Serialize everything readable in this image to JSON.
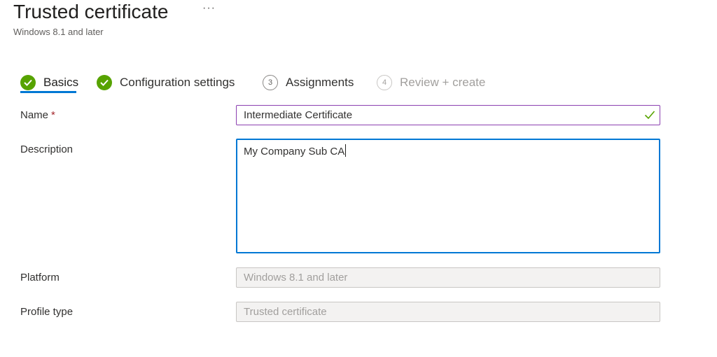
{
  "header": {
    "title": "Trusted certificate",
    "more_label": "···",
    "subtitle": "Windows 8.1 and later"
  },
  "steps": [
    {
      "label": "Basics",
      "state": "complete",
      "icon": "checkmark-circle-icon"
    },
    {
      "label": "Configuration settings",
      "state": "complete",
      "icon": "checkmark-circle-icon"
    },
    {
      "label": "Assignments",
      "number": "3",
      "state": "pending"
    },
    {
      "label": "Review + create",
      "number": "4",
      "state": "disabled"
    }
  ],
  "form": {
    "name": {
      "label": "Name",
      "required_marker": "*",
      "value": "Intermediate Certificate",
      "valid": true
    },
    "description": {
      "label": "Description",
      "value": "My Company Sub CA"
    },
    "platform": {
      "label": "Platform",
      "value": "Windows 8.1 and later"
    },
    "profile_type": {
      "label": "Profile type",
      "value": "Trusted certificate"
    }
  },
  "colors": {
    "accent": "#0078d4",
    "success": "#57a300",
    "required": "#a4262c",
    "name_border": "#8b3fb0"
  }
}
